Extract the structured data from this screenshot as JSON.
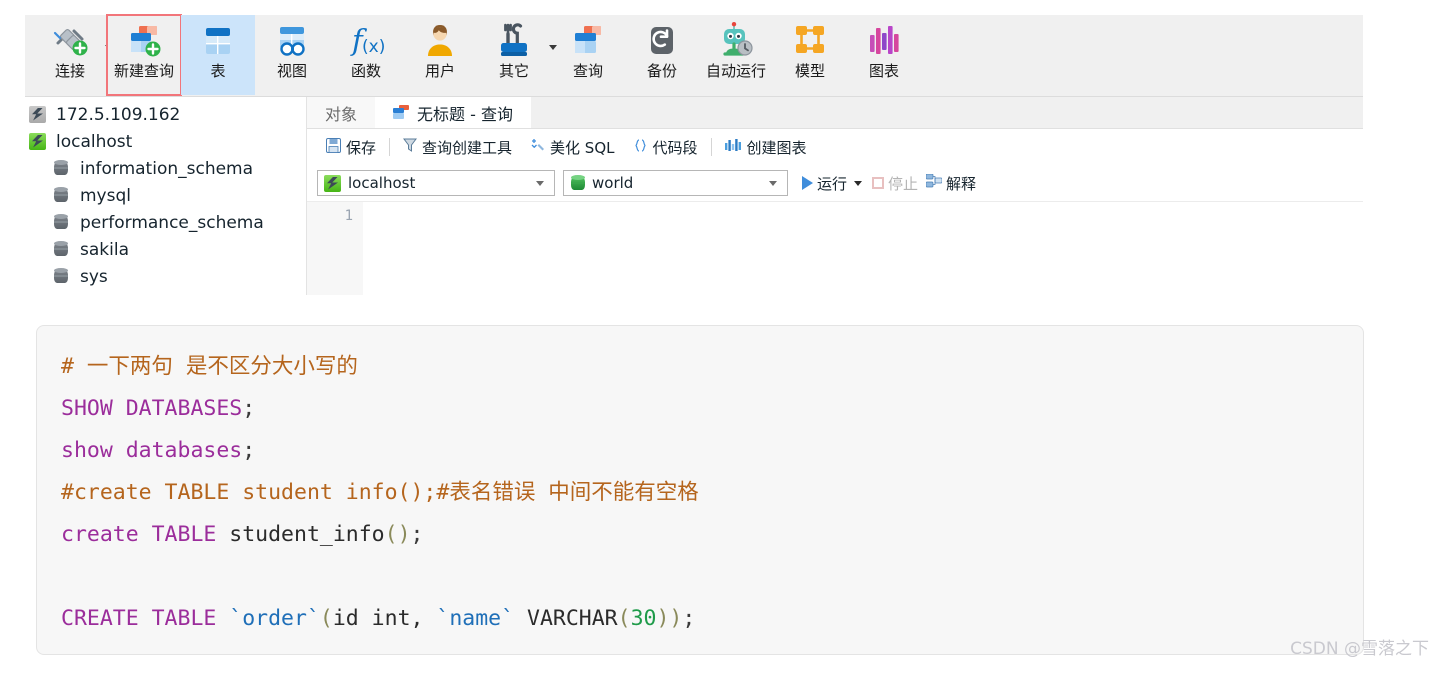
{
  "toolbar": {
    "items": [
      {
        "label": "连接",
        "icon": "connect-plug-icon",
        "caret": true,
        "selected": false,
        "boxed": false
      },
      {
        "label": "新建查询",
        "icon": "new-query-icon",
        "caret": false,
        "selected": false,
        "boxed": true
      },
      {
        "label": "表",
        "icon": "table-icon",
        "caret": false,
        "selected": true,
        "boxed": false
      },
      {
        "label": "视图",
        "icon": "view-icon",
        "caret": false,
        "selected": false,
        "boxed": false
      },
      {
        "label": "函数",
        "icon": "function-fx-icon",
        "caret": false,
        "selected": false,
        "boxed": false
      },
      {
        "label": "用户",
        "icon": "user-icon",
        "caret": false,
        "selected": false,
        "boxed": false
      },
      {
        "label": "其它",
        "icon": "other-tools-icon",
        "caret": true,
        "selected": false,
        "boxed": false
      },
      {
        "label": "查询",
        "icon": "query-icon",
        "caret": false,
        "selected": false,
        "boxed": false
      },
      {
        "label": "备份",
        "icon": "backup-icon",
        "caret": false,
        "selected": false,
        "boxed": false
      },
      {
        "label": "自动运行",
        "icon": "automation-bot-icon",
        "caret": false,
        "selected": false,
        "boxed": false
      },
      {
        "label": "模型",
        "icon": "model-icon",
        "caret": false,
        "selected": false,
        "boxed": false
      },
      {
        "label": "图表",
        "icon": "chart-icon",
        "caret": false,
        "selected": false,
        "boxed": false
      }
    ],
    "highlight_box_color": "#f2757a"
  },
  "sidebar": {
    "items": [
      {
        "label": "172.5.109.162",
        "icon": "server-icon",
        "state": "offline",
        "level": 0
      },
      {
        "label": "localhost",
        "icon": "server-icon",
        "state": "online",
        "level": 0
      },
      {
        "label": "information_schema",
        "icon": "database-icon",
        "state": "",
        "level": 1
      },
      {
        "label": "mysql",
        "icon": "database-icon",
        "state": "",
        "level": 1
      },
      {
        "label": "performance_schema",
        "icon": "database-icon",
        "state": "",
        "level": 1
      },
      {
        "label": "sakila",
        "icon": "database-icon",
        "state": "",
        "level": 1
      },
      {
        "label": "sys",
        "icon": "database-icon",
        "state": "",
        "level": 1
      }
    ]
  },
  "tabs": {
    "object_tab": "对象",
    "query_tab": "无标题 - 查询"
  },
  "query_toolbar": {
    "save": "保存",
    "query_builder": "查询创建工具",
    "beautify_sql": "美化 SQL",
    "code_snippet": "代码段",
    "create_chart": "创建图表"
  },
  "run_row": {
    "connection": "localhost",
    "database": "world",
    "run": "运行",
    "stop": "停止",
    "explain": "解释"
  },
  "editor": {
    "line_numbers": [
      "1"
    ],
    "content": ""
  },
  "code_block": {
    "lines": [
      {
        "tokens": [
          {
            "t": "# 一下两句 是不区分大小写的",
            "c": "comment"
          }
        ]
      },
      {
        "tokens": [
          {
            "t": "SHOW DATABASES",
            "c": "keyword"
          },
          {
            "t": ";",
            "c": "punct"
          }
        ]
      },
      {
        "tokens": [
          {
            "t": "show databases",
            "c": "keyword"
          },
          {
            "t": ";",
            "c": "punct"
          }
        ]
      },
      {
        "tokens": [
          {
            "t": "#create TABLE student info();#表名错误 中间不能有空格",
            "c": "comment"
          }
        ]
      },
      {
        "tokens": [
          {
            "t": "create TABLE ",
            "c": "keyword"
          },
          {
            "t": "student_info",
            "c": "ident"
          },
          {
            "t": "()",
            "c": "paren"
          },
          {
            "t": ";",
            "c": "punct"
          }
        ]
      },
      {
        "tokens": []
      },
      {
        "tokens": [
          {
            "t": "CREATE TABLE ",
            "c": "keyword"
          },
          {
            "t": "`order`",
            "c": "quoted"
          },
          {
            "t": "(",
            "c": "paren"
          },
          {
            "t": "id int, ",
            "c": "ident"
          },
          {
            "t": "`name`",
            "c": "quoted"
          },
          {
            "t": " VARCHAR",
            "c": "ident"
          },
          {
            "t": "(",
            "c": "paren"
          },
          {
            "t": "30",
            "c": "number"
          },
          {
            "t": "))",
            "c": "paren"
          },
          {
            "t": ";",
            "c": "punct"
          }
        ]
      }
    ]
  },
  "watermark": {
    "text": "CSDN @雪落之下"
  },
  "colors": {
    "toolbar_bg": "#f0f0f0",
    "selected_tab_bg": "#cce4fa",
    "highlight_outline": "#f2757a",
    "comment": "#b5651d",
    "keyword": "#9b2d9b",
    "identifier": "#2b2b2b",
    "quoted_identifier": "#1f6fb8",
    "number": "#1f9b4a",
    "paren": "#8a8a5a",
    "code_bg": "#f7f7f7",
    "watermark": "#c9c9cf"
  }
}
